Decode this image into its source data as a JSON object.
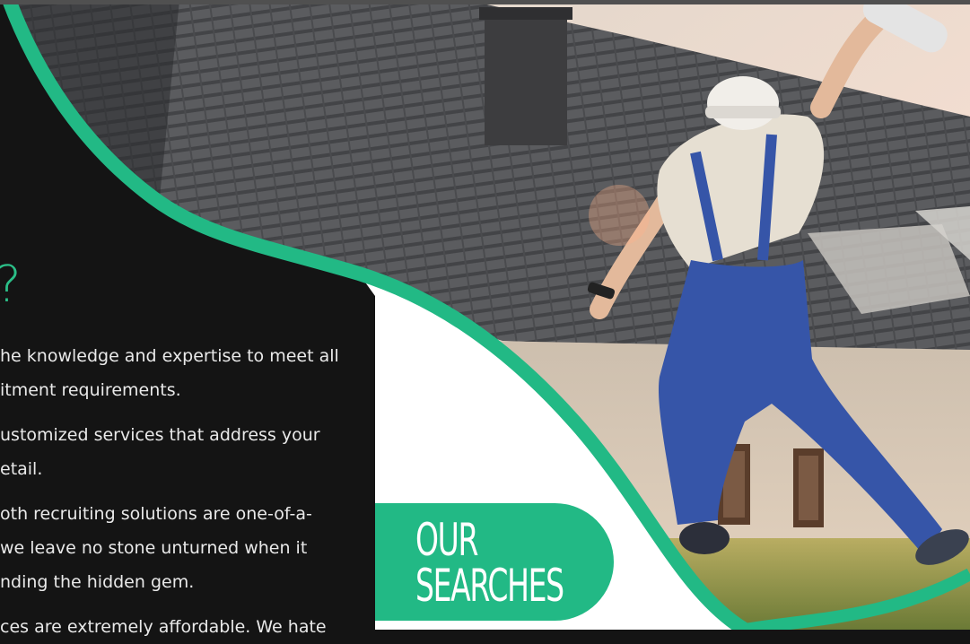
{
  "colors": {
    "accent_green": "#22b985",
    "dark_panel": "#141414",
    "white": "#ffffff"
  },
  "hero_image": {
    "icon": "photo-worker-jumping-house",
    "alt_subject": "worker in blue overalls and hard hat jumping in front of a house with tiled roof"
  },
  "left_panel": {
    "heading": "?",
    "paragraphs": [
      {
        "line1": "he knowledge and expertise to meet all",
        "line2": "itment requirements."
      },
      {
        "line1": "ustomized services that address your",
        "line2": "etail."
      },
      {
        "line1": "oth recruiting solutions are one-of-a-",
        "line2": "we leave no stone unturned when it",
        "line3": "nding the hidden gem."
      },
      {
        "line1": "ces are extremely affordable. We hate"
      }
    ]
  },
  "our_searches": {
    "line1": "OUR",
    "line2": "SEARCHES"
  }
}
